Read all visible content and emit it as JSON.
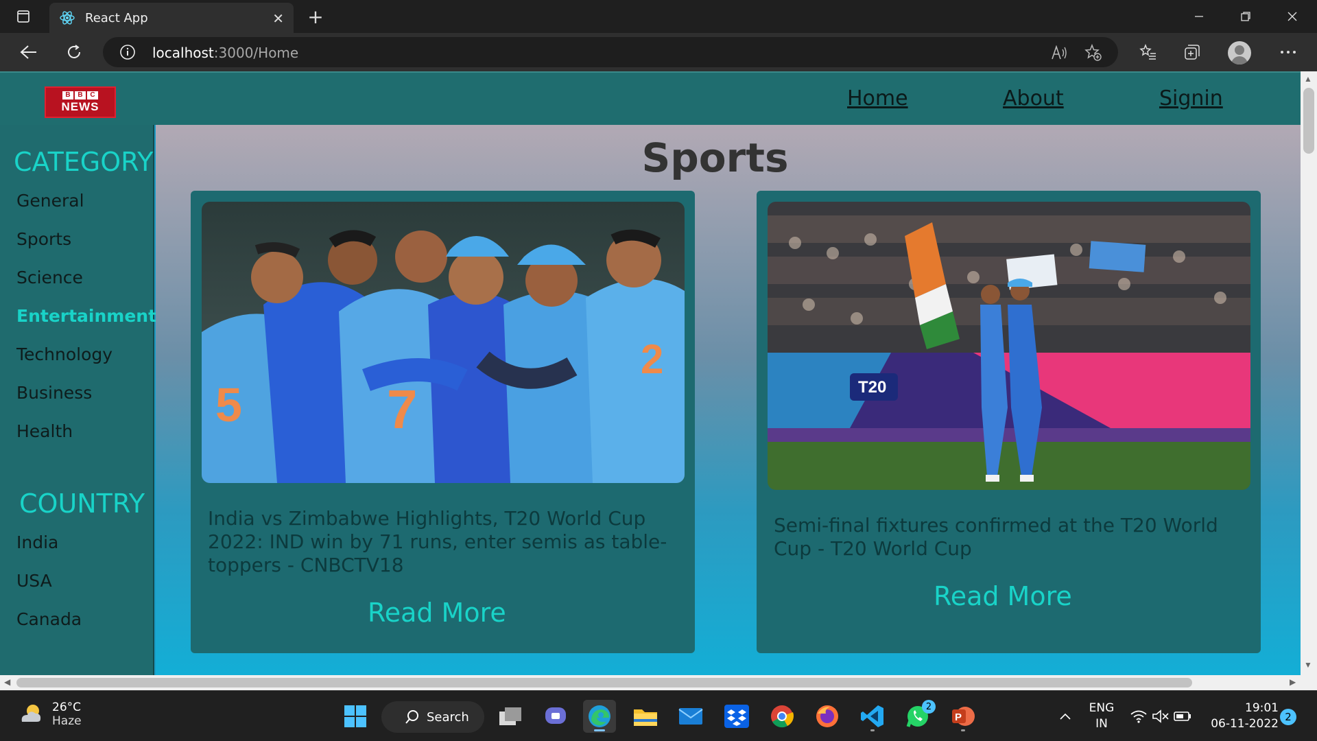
{
  "browser": {
    "tab_title": "React App",
    "url_host": "localhost",
    "url_path": ":3000/Home"
  },
  "navbar": {
    "logo_text_top": "BBC",
    "logo_text_bottom": "NEWS",
    "links": [
      "Home",
      "About",
      "Signin"
    ]
  },
  "sidebar": {
    "category_heading": "CATEGORY",
    "categories": [
      "General",
      "Sports",
      "Science",
      "Entertainment",
      "Technology",
      "Business",
      "Health"
    ],
    "active_category": "Entertainment",
    "country_heading": "COUNTRY",
    "countries": [
      "India",
      "USA",
      "Canada"
    ]
  },
  "main": {
    "title": "Sports",
    "cards": [
      {
        "headline": "India vs Zimbabwe Highlights, T20 World Cup 2022: IND win by 71 runs, enter semis as table-toppers - CNBCTV18",
        "read_more": "Read More",
        "image": "cricket-team-celebration-photo"
      },
      {
        "headline": "Semi-final fixtures confirmed at the T20 World Cup - T20 World Cup",
        "read_more": "Read More",
        "image": "cricket-players-stadium-photo"
      }
    ]
  },
  "taskbar": {
    "weather_temp": "26°C",
    "weather_condition": "Haze",
    "search_label": "Search",
    "whatsapp_badge": "2",
    "lang_top": "ENG",
    "lang_bottom": "IN",
    "time": "19:01",
    "date": "06-11-2022",
    "notification_count": "2"
  },
  "colors": {
    "accent": "#19d3c8",
    "navbar": "#1f6d6f",
    "sidebar": "#1f6b6e",
    "card": "#1d6a70"
  }
}
